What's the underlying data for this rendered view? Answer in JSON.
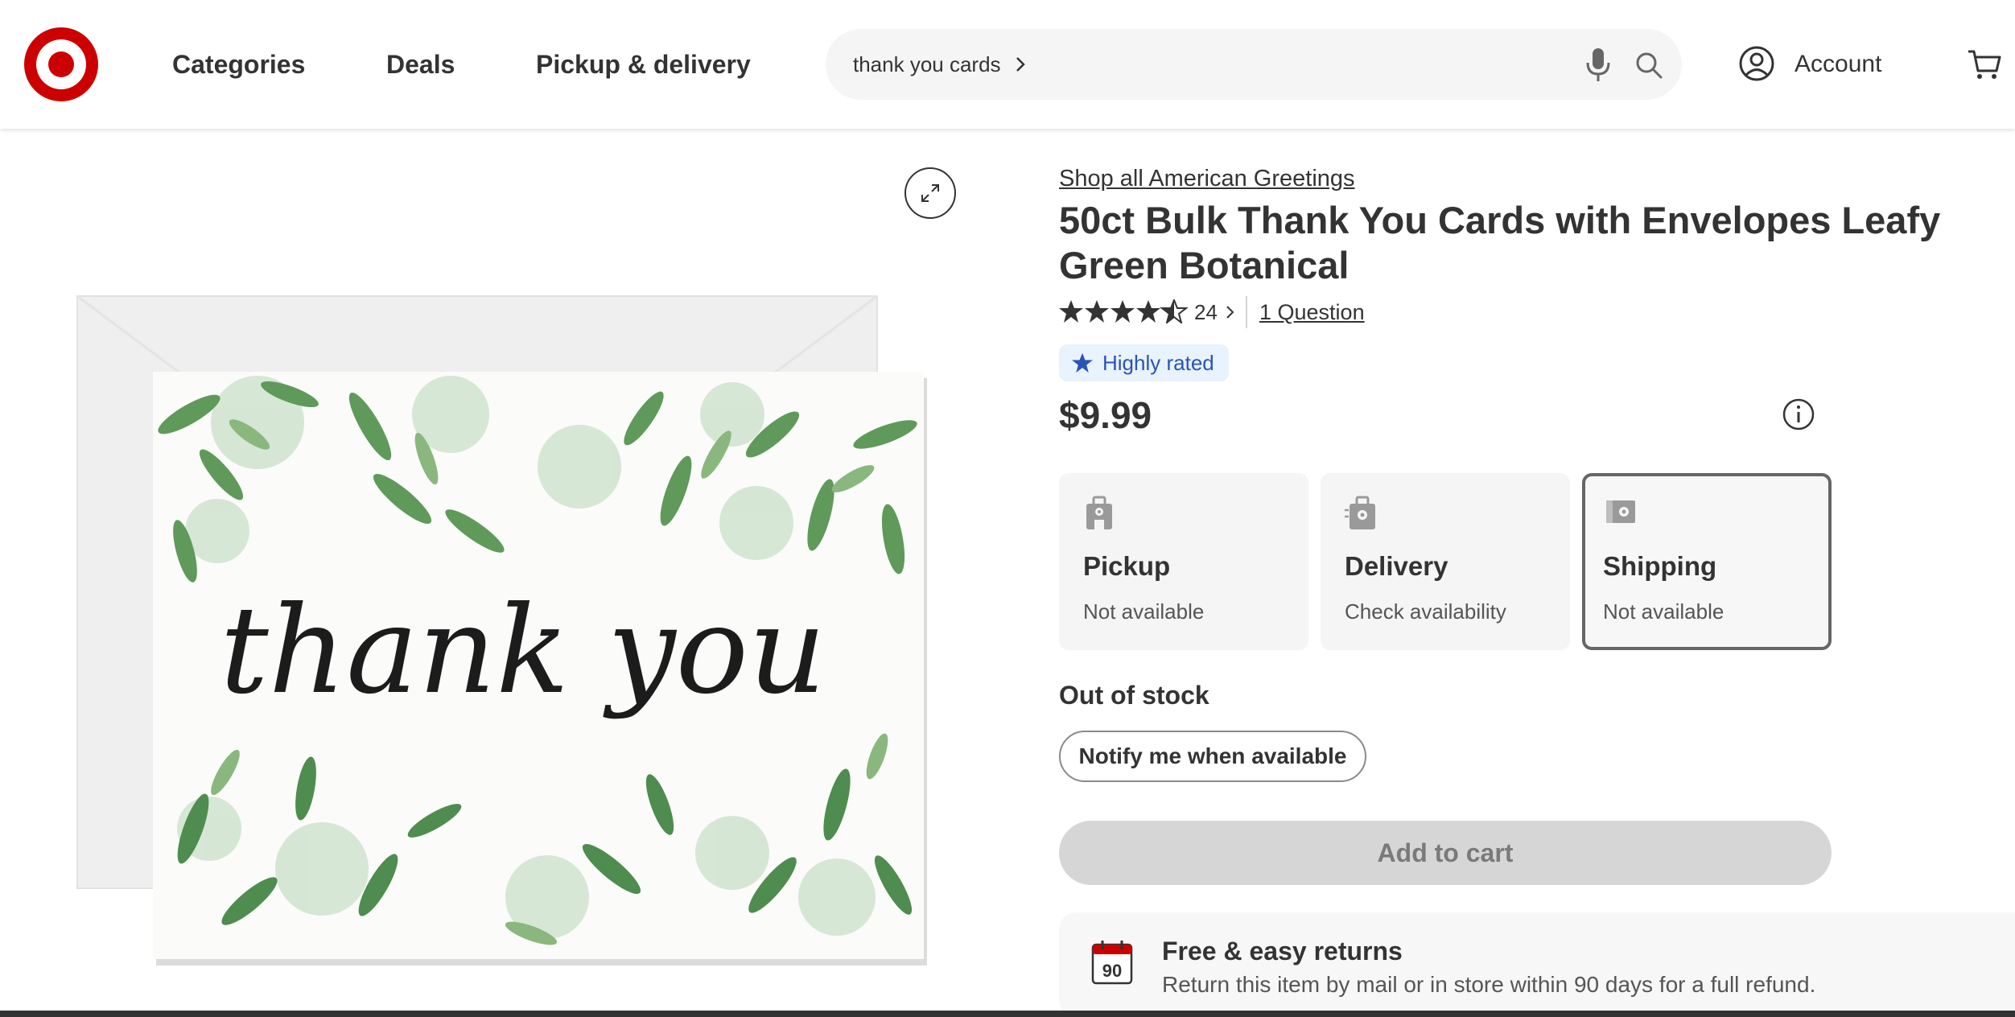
{
  "header": {
    "nav": [
      "Categories",
      "Deals",
      "Pickup & delivery"
    ],
    "search": {
      "value": "thank you cards"
    },
    "account_label": "Account"
  },
  "product": {
    "brand_link": "Shop all American Greetings",
    "title": "50ct Bulk Thank You Cards with Envelopes Leafy Green Botanical",
    "rating": {
      "stars": 4.5,
      "count": "24",
      "questions": "1 Question"
    },
    "badge": "Highly rated",
    "price": "$9.99",
    "image_text": "thank you"
  },
  "fulfillment": [
    {
      "label": "Pickup",
      "status": "Not available",
      "icon": "store-pickup-icon",
      "selected": false
    },
    {
      "label": "Delivery",
      "status": "Check availability",
      "icon": "delivery-bag-icon",
      "selected": false
    },
    {
      "label": "Shipping",
      "status": "Not available",
      "icon": "shipping-box-icon",
      "selected": true
    }
  ],
  "stock_status": "Out of stock",
  "buttons": {
    "notify": "Notify me when available",
    "add_to_cart": "Add to cart"
  },
  "returns": {
    "title": "Free & easy returns",
    "description": "Return this item by mail or in store within 90 days for a full refund.",
    "calendar_number": "90"
  },
  "colors": {
    "brand_red": "#cc0000",
    "text": "#333333",
    "badge_bg": "#e9f3fd",
    "badge_text": "#2b53b7"
  }
}
